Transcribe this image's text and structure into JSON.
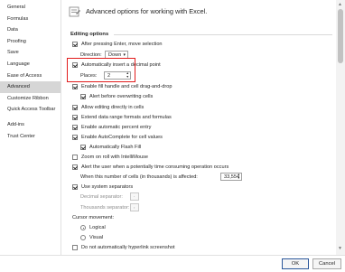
{
  "sidebar": {
    "items": [
      {
        "label": "General"
      },
      {
        "label": "Formulas"
      },
      {
        "label": "Data"
      },
      {
        "label": "Proofing"
      },
      {
        "label": "Save"
      },
      {
        "label": "Language"
      },
      {
        "label": "Ease of Access"
      },
      {
        "label": "Advanced"
      },
      {
        "label": "Customize Ribbon"
      },
      {
        "label": "Quick Access Toolbar"
      },
      {
        "label": "Add-ins"
      },
      {
        "label": "Trust Center"
      }
    ],
    "selected": "Advanced"
  },
  "header": {
    "title": "Advanced options for working with Excel."
  },
  "editing": {
    "section_title": "Editing options",
    "after_enter": {
      "label": "After pressing Enter, move selection",
      "checked": true
    },
    "direction": {
      "label": "Direction:",
      "value": "Down"
    },
    "decimal_point": {
      "label": "Automatically insert a decimal point",
      "checked": true
    },
    "places": {
      "label": "Places:",
      "value": "2"
    },
    "fill_handle": {
      "label": "Enable fill handle and cell drag-and-drop",
      "checked": true
    },
    "alert_overwrite": {
      "label": "Alert before overwriting cells",
      "checked": true
    },
    "editing_in_cells": {
      "label": "Allow editing directly in cells",
      "checked": true
    },
    "extend_formats": {
      "label": "Extend data range formats and formulas",
      "checked": true
    },
    "auto_percent": {
      "label": "Enable automatic percent entry",
      "checked": true
    },
    "autocomplete": {
      "label": "Enable AutoComplete for cell values",
      "checked": true
    },
    "flash_fill": {
      "label": "Automatically Flash Fill",
      "checked": true
    },
    "zoom_roll": {
      "label": "Zoom on roll with IntelliMouse",
      "checked": false
    },
    "alert_time": {
      "label": "Alert the user when a potentially time consuming operation occurs",
      "checked": true
    },
    "cells_affected": {
      "label": "When this number of cells (in thousands) is affected:",
      "value": "33,554"
    },
    "system_separators": {
      "label": "Use system separators",
      "checked": true
    },
    "decimal_separator": {
      "label": "Decimal separator:",
      "value": "."
    },
    "thousands_separator": {
      "label": "Thousands separator:",
      "value": ","
    },
    "cursor_movement": {
      "label": "Cursor movement:",
      "options": [
        {
          "label": "Logical",
          "checked": true
        },
        {
          "label": "Visual",
          "checked": false
        }
      ]
    },
    "hyperlink_screenshot": {
      "label": "Do not automatically hyperlink screenshot",
      "checked": false
    }
  },
  "footer": {
    "ok_label": "OK",
    "cancel_label": "Cancel"
  },
  "colors": {
    "highlight": "#e21c1c",
    "selected_bg": "#d6d6d6",
    "accent": "#2b579a"
  }
}
